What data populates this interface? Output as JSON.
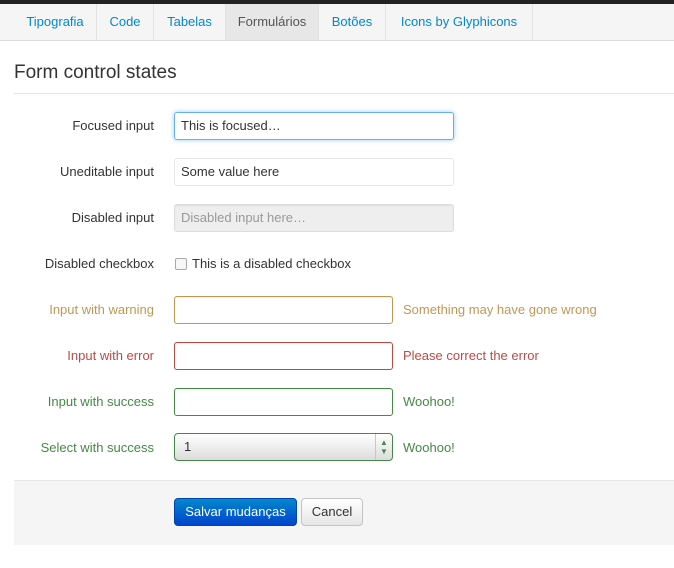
{
  "tabs": [
    "Tipografia",
    "Code",
    "Tabelas",
    "Formulários",
    "Botões",
    "Icons by Glyphicons"
  ],
  "active_tab": "Formulários",
  "section_title": "Form control states",
  "fields": {
    "focused": {
      "label": "Focused input",
      "value": "This is focused…"
    },
    "uneditable": {
      "label": "Uneditable input",
      "value": "Some value here"
    },
    "disabled": {
      "label": "Disabled input",
      "placeholder": "Disabled input here…"
    },
    "disabled_checkbox": {
      "label": "Disabled checkbox",
      "text": "This is a disabled checkbox"
    },
    "warning": {
      "label": "Input with warning",
      "help": "Something may have gone wrong"
    },
    "error": {
      "label": "Input with error",
      "help": "Please correct the error"
    },
    "success": {
      "label": "Input with success",
      "help": "Woohoo!"
    },
    "select_success": {
      "label": "Select with success",
      "selected": "1",
      "help": "Woohoo!"
    }
  },
  "actions": {
    "save": "Salvar mudanças",
    "cancel": "Cancel"
  },
  "colors": {
    "link": "#0088cc",
    "warning": "#c09853",
    "error": "#b94a48",
    "success": "#468847",
    "primary": "#0074cc"
  }
}
